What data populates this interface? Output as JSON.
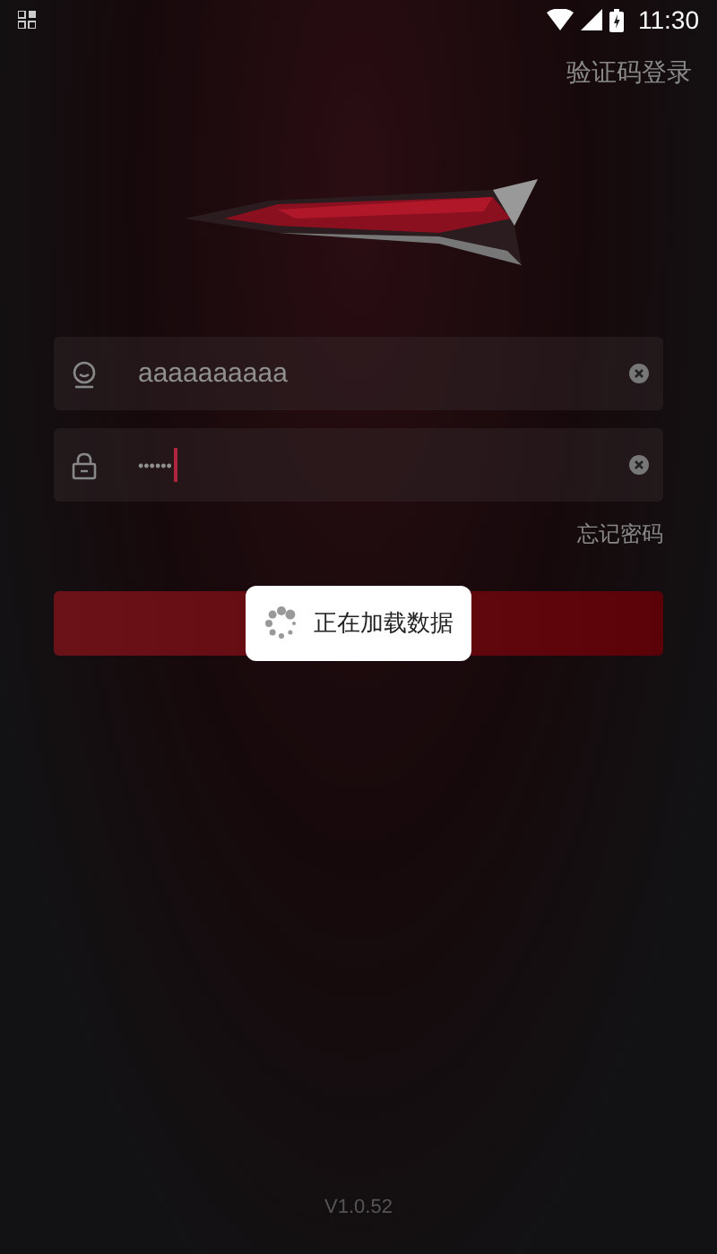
{
  "status_bar": {
    "time": "11:30"
  },
  "header": {
    "link": "验证码登录"
  },
  "form": {
    "fields": [
      {
        "kind": "user",
        "value": "aaaaaaaaaa",
        "focused": false
      },
      {
        "kind": "password",
        "value": "••••••",
        "focused": true
      }
    ],
    "forgot_link": "忘记密码"
  },
  "toast": {
    "text": "正在加载数据"
  },
  "version": "V1.0.52"
}
